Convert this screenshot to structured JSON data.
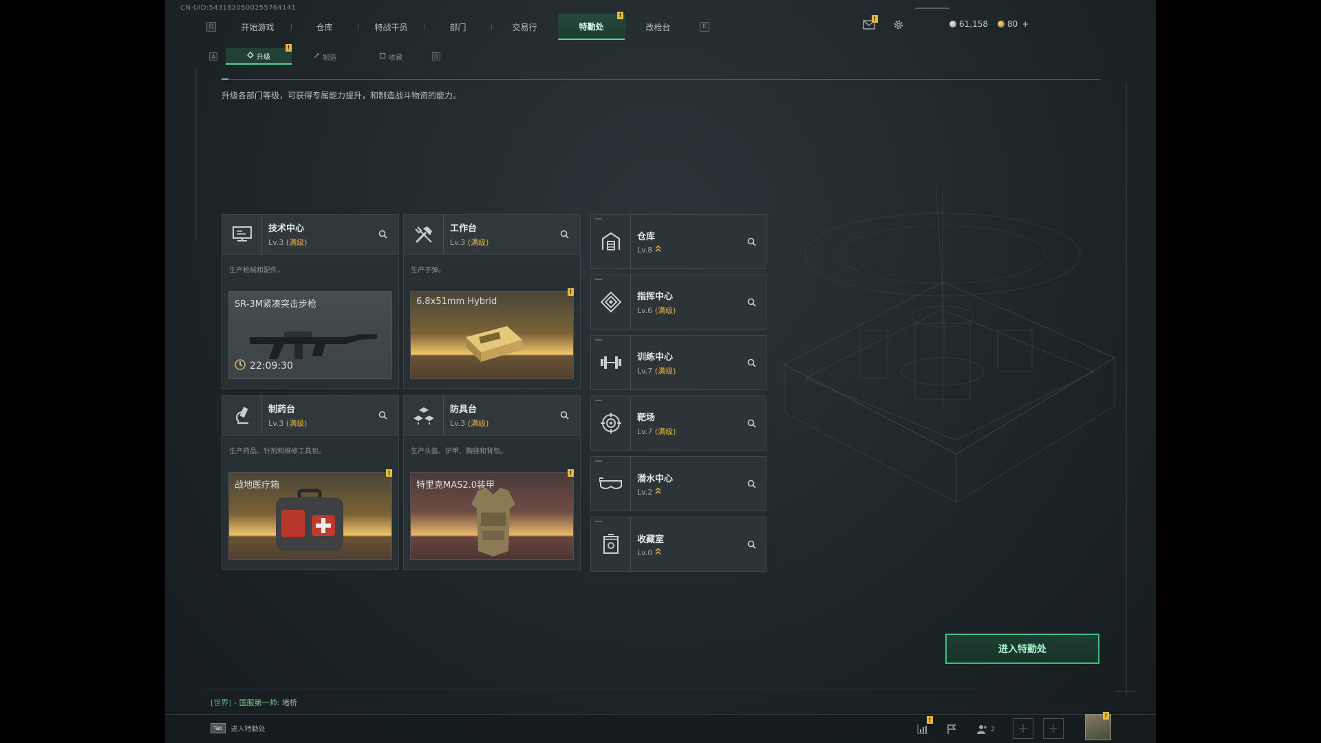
{
  "uid": "CN-UID:5431820500255764141",
  "nav": {
    "left_key": "Q",
    "right_key": "E",
    "tabs": [
      "开始游戏",
      "仓库",
      "特战干员",
      "部门",
      "交易行",
      "特勤处",
      "改枪台"
    ],
    "active_index": 5
  },
  "currency": {
    "silver": "61,158",
    "gold": "80",
    "gold_add": "+"
  },
  "subnav": {
    "left_key": "A",
    "right_key": "D",
    "tabs": [
      "升级",
      "制造",
      "收藏"
    ],
    "active_index": 0
  },
  "description": "升级各部门等级，可获得专属能力提升，和制造战斗物资的能力。",
  "alert_mark": "!",
  "max_text": "(满级)",
  "cards": [
    {
      "title": "技术中心",
      "level": "Lv.3",
      "max": true,
      "subtitle": "生产枪械和配件。",
      "product": "SR-3M紧凑突击步枪",
      "timer": "22:09:30",
      "style": "gray",
      "alert": false
    },
    {
      "title": "工作台",
      "level": "Lv.3",
      "max": true,
      "subtitle": "生产子弹。",
      "product": "6.8x51mm Hybrid",
      "style": "gold",
      "alert": true
    },
    {
      "title": "制药台",
      "level": "Lv.3",
      "max": true,
      "subtitle": "生产药品、针剂和维修工具包。",
      "product": "战地医疗箱",
      "style": "gold",
      "alert": true
    },
    {
      "title": "防具台",
      "level": "Lv.3",
      "max": true,
      "subtitle": "生产头盔、护甲、胸挂和背包。",
      "product": "特里克MAS2.0装甲",
      "style": "wine",
      "alert": true
    }
  ],
  "facilities": [
    {
      "title": "仓库",
      "level": "Lv.8",
      "max": false,
      "icon": "warehouse-icon"
    },
    {
      "title": "指挥中心",
      "level": "Lv.6",
      "max": true,
      "icon": "command-icon"
    },
    {
      "title": "训练中心",
      "level": "Lv.7",
      "max": true,
      "icon": "dumbbell-icon"
    },
    {
      "title": "靶场",
      "level": "Lv.7",
      "max": true,
      "icon": "target-icon"
    },
    {
      "title": "潜水中心",
      "level": "Lv.2",
      "max": false,
      "icon": "goggles-icon"
    },
    {
      "title": "收藏室",
      "level": "Lv.0",
      "max": false,
      "icon": "trophy-icon"
    }
  ],
  "enter_button": "进入特勤处",
  "chat": {
    "channel": "[世界]",
    "sep": " - ",
    "sender": "国服第一帅:",
    "message": " 堵桥"
  },
  "bottom": {
    "tab_key": "Tab",
    "tab_label": "进入特勤处",
    "friends_count": "2"
  },
  "colors": {
    "accent_green": "#4fd69b",
    "alert_yellow": "#e8b93a",
    "max_gold": "#e6b43c"
  }
}
